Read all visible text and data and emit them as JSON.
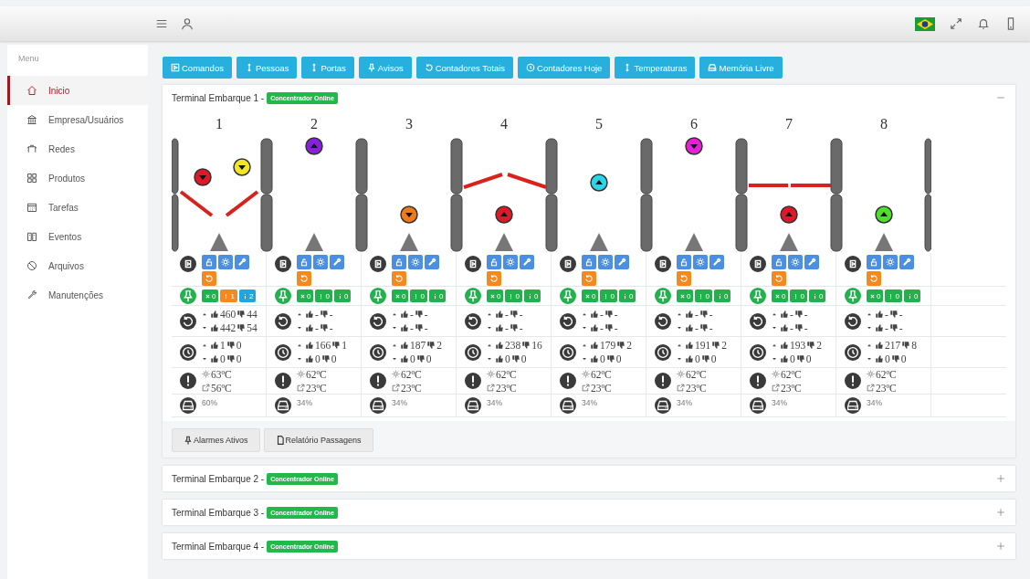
{
  "sidebar": {
    "heading": "Menu",
    "items": [
      {
        "label": "Inicio",
        "selected": true
      },
      {
        "label": "Empresa/Usuários",
        "selected": false
      },
      {
        "label": "Redes",
        "selected": false
      },
      {
        "label": "Produtos",
        "selected": false
      },
      {
        "label": "Tarefas",
        "selected": false
      },
      {
        "label": "Eventos",
        "selected": false
      },
      {
        "label": "Arquivos",
        "selected": false
      },
      {
        "label": "Manutenções",
        "selected": false
      }
    ]
  },
  "toolbar": [
    "Comandos",
    "Pessoas",
    "Portas",
    "Avisos",
    "Contadores Totais",
    "Contadores Hoje",
    "Temperaturas",
    "Memória Livre"
  ],
  "terminals": [
    {
      "title": "Terminal Embarque 1 -",
      "status": "Concentrador Online",
      "expanded": true,
      "gates": [
        {
          "number": "1",
          "kind": "open",
          "indicators": [
            {
              "color": "#e0182a",
              "up": false,
              "kind": "left"
            },
            {
              "color": "#f4e52a",
              "up": false,
              "kind": "right"
            }
          ],
          "alarms": [
            {
              "value": "0",
              "color": "#22b14c"
            },
            {
              "value": "1",
              "color": "#f5891f"
            },
            {
              "value": "2",
              "color": "#1ea6e0"
            }
          ],
          "totals": {
            "up_ok": "460",
            "up_fail": "44",
            "down_ok": "442",
            "down_fail": "54"
          },
          "today": {
            "up_ok": "1",
            "up_fail": "0",
            "down_ok": "0",
            "down_fail": "0"
          },
          "temp_cpu": "63ºC",
          "temp_ambient": "56ºC",
          "memory": "60%"
        },
        {
          "number": "2",
          "kind": "plain",
          "indicators": [
            {
              "color": "#8a1fe0",
              "up": true,
              "kind": "top"
            }
          ],
          "alarms": [
            {
              "value": "0",
              "color": "#22b14c"
            },
            {
              "value": "0",
              "color": "#22b14c"
            },
            {
              "value": "0",
              "color": "#22b14c"
            }
          ],
          "totals": {
            "up_ok": "-",
            "up_fail": "-",
            "down_ok": "-",
            "down_fail": "-"
          },
          "today": {
            "up_ok": "166",
            "up_fail": "1",
            "down_ok": "0",
            "down_fail": "0"
          },
          "temp_cpu": "62ºC",
          "temp_ambient": "23ºC",
          "memory": "34%"
        },
        {
          "number": "3",
          "kind": "plain",
          "indicators": [
            {
              "color": "#f07a1a",
              "up": false,
              "kind": "low"
            }
          ],
          "alarms": [
            {
              "value": "0",
              "color": "#22b14c"
            },
            {
              "value": "0",
              "color": "#22b14c"
            },
            {
              "value": "0",
              "color": "#22b14c"
            }
          ],
          "totals": {
            "up_ok": "-",
            "up_fail": "-",
            "down_ok": "-",
            "down_fail": "-"
          },
          "today": {
            "up_ok": "187",
            "up_fail": "2",
            "down_ok": "0",
            "down_fail": "0"
          },
          "temp_cpu": "62ºC",
          "temp_ambient": "23ºC",
          "memory": "34%"
        },
        {
          "number": "4",
          "kind": "raised",
          "indicators": [
            {
              "color": "#e0182a",
              "up": true,
              "kind": "low"
            }
          ],
          "alarms": [
            {
              "value": "0",
              "color": "#22b14c"
            },
            {
              "value": "0",
              "color": "#22b14c"
            },
            {
              "value": "0",
              "color": "#22b14c"
            }
          ],
          "totals": {
            "up_ok": "-",
            "up_fail": "-",
            "down_ok": "-",
            "down_fail": "-"
          },
          "today": {
            "up_ok": "238",
            "up_fail": "16",
            "down_ok": "0",
            "down_fail": "0"
          },
          "temp_cpu": "62ºC",
          "temp_ambient": "23ºC",
          "memory": "34%"
        },
        {
          "number": "5",
          "kind": "plain",
          "indicators": [
            {
              "color": "#2ad6e8",
              "up": true,
              "kind": "middle"
            }
          ],
          "alarms": [
            {
              "value": "0",
              "color": "#22b14c"
            },
            {
              "value": "0",
              "color": "#22b14c"
            },
            {
              "value": "0",
              "color": "#22b14c"
            }
          ],
          "totals": {
            "up_ok": "-",
            "up_fail": "-",
            "down_ok": "-",
            "down_fail": "-"
          },
          "today": {
            "up_ok": "179",
            "up_fail": "2",
            "down_ok": "0",
            "down_fail": "0"
          },
          "temp_cpu": "62ºC",
          "temp_ambient": "23ºC",
          "memory": "34%"
        },
        {
          "number": "6",
          "kind": "plain",
          "indicators": [
            {
              "color": "#e81fd8",
              "up": false,
              "kind": "top"
            }
          ],
          "alarms": [
            {
              "value": "0",
              "color": "#22b14c"
            },
            {
              "value": "0",
              "color": "#22b14c"
            },
            {
              "value": "0",
              "color": "#22b14c"
            }
          ],
          "totals": {
            "up_ok": "-",
            "up_fail": "-",
            "down_ok": "-",
            "down_fail": "-"
          },
          "today": {
            "up_ok": "191",
            "up_fail": "2",
            "down_ok": "0",
            "down_fail": "0"
          },
          "temp_cpu": "62ºC",
          "temp_ambient": "23ºC",
          "memory": "34%"
        },
        {
          "number": "7",
          "kind": "closed",
          "indicators": [
            {
              "color": "#e0182a",
              "up": true,
              "kind": "low"
            }
          ],
          "alarms": [
            {
              "value": "0",
              "color": "#22b14c"
            },
            {
              "value": "0",
              "color": "#22b14c"
            },
            {
              "value": "0",
              "color": "#22b14c"
            }
          ],
          "totals": {
            "up_ok": "-",
            "up_fail": "-",
            "down_ok": "-",
            "down_fail": "-"
          },
          "today": {
            "up_ok": "193",
            "up_fail": "2",
            "down_ok": "0",
            "down_fail": "0"
          },
          "temp_cpu": "62ºC",
          "temp_ambient": "23ºC",
          "memory": "34%"
        },
        {
          "number": "8",
          "kind": "plain",
          "indicators": [
            {
              "color": "#4ee02a",
              "up": true,
              "kind": "low"
            }
          ],
          "alarms": [
            {
              "value": "0",
              "color": "#22b14c"
            },
            {
              "value": "0",
              "color": "#22b14c"
            },
            {
              "value": "0",
              "color": "#22b14c"
            }
          ],
          "totals": {
            "up_ok": "-",
            "up_fail": "-",
            "down_ok": "-",
            "down_fail": "-"
          },
          "today": {
            "up_ok": "217",
            "up_fail": "8",
            "down_ok": "0",
            "down_fail": "0"
          },
          "temp_cpu": "62ºC",
          "temp_ambient": "23ºC",
          "memory": "34%"
        }
      ],
      "actions": [
        "Alarmes Ativos",
        "Relatório Passagens"
      ]
    },
    {
      "title": "Terminal Embarque 2 -",
      "status": "Concentrador Online",
      "expanded": false
    },
    {
      "title": "Terminal Embarque 3 -",
      "status": "Concentrador Online",
      "expanded": false
    },
    {
      "title": "Terminal Embarque 4 -",
      "status": "Concentrador Online",
      "expanded": false
    }
  ]
}
